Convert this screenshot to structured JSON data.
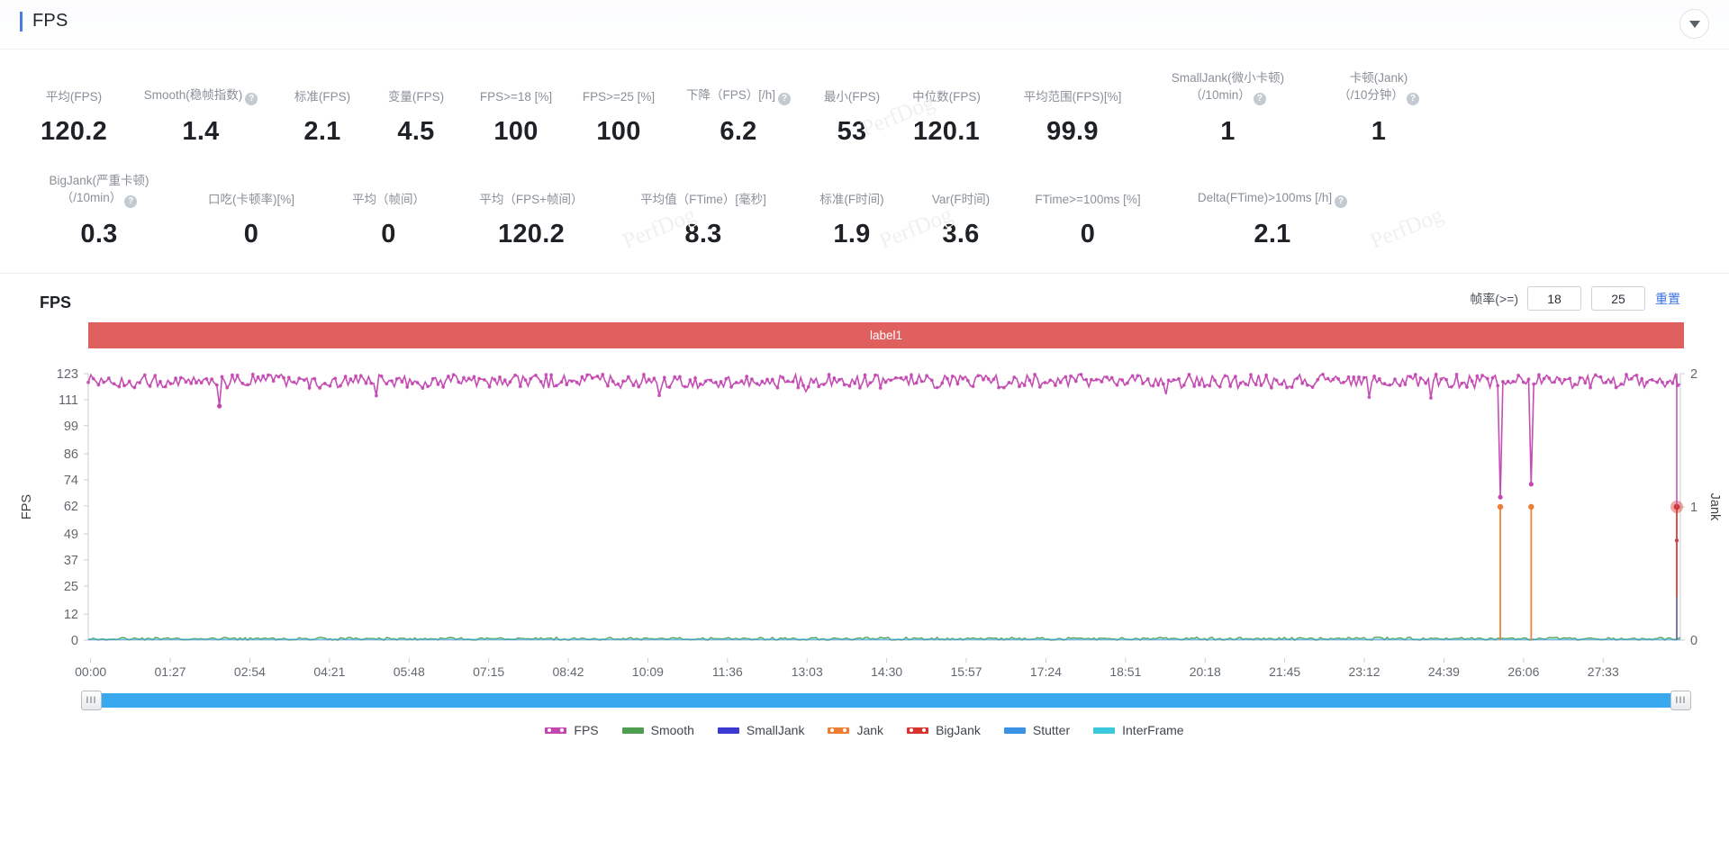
{
  "header": {
    "title": "FPS",
    "collapse_icon": "chevron-down-icon"
  },
  "stats": {
    "row1": [
      {
        "label": "平均(FPS)",
        "label2": "",
        "help": false,
        "value": "120.2"
      },
      {
        "label": "Smooth(稳帧指数)",
        "label2": "",
        "help": true,
        "value": "1.4"
      },
      {
        "label": "标准(FPS)",
        "label2": "",
        "help": false,
        "value": "2.1"
      },
      {
        "label": "变量(FPS)",
        "label2": "",
        "help": false,
        "value": "4.5"
      },
      {
        "label": "FPS>=18 [%]",
        "label2": "",
        "help": false,
        "value": "100"
      },
      {
        "label": "FPS>=25 [%]",
        "label2": "",
        "help": false,
        "value": "100"
      },
      {
        "label": "下降（FPS）[/h]",
        "label2": "",
        "help": true,
        "value": "6.2"
      },
      {
        "label": "最小(FPS)",
        "label2": "",
        "help": false,
        "value": "53"
      },
      {
        "label": "中位数(FPS)",
        "label2": "",
        "help": false,
        "value": "120.1"
      },
      {
        "label": "平均范围(FPS)[%]",
        "label2": "",
        "help": false,
        "value": "99.9"
      },
      {
        "label": "SmallJank(微小卡顿)",
        "label2": "（/10min）",
        "help": true,
        "value": "1"
      },
      {
        "label": "卡顿(Jank)",
        "label2": "（/10分钟）",
        "help": true,
        "value": "1"
      }
    ],
    "row2": [
      {
        "label": "BigJank(严重卡顿)",
        "label2": "（/10min）",
        "help": true,
        "value": "0.3"
      },
      {
        "label": "口吃(卡顿率)[%]",
        "label2": "",
        "help": false,
        "value": "0"
      },
      {
        "label": "平均（帧间）",
        "label2": "",
        "help": false,
        "value": "0"
      },
      {
        "label": "平均（FPS+帧间）",
        "label2": "",
        "help": false,
        "value": "120.2"
      },
      {
        "label": "平均值（FTime）[毫秒]",
        "label2": "",
        "help": false,
        "value": "8.3"
      },
      {
        "label": "标准(F时间)",
        "label2": "",
        "help": false,
        "value": "1.9"
      },
      {
        "label": "Var(F时间)",
        "label2": "",
        "help": false,
        "value": "3.6"
      },
      {
        "label": "FTime>=100ms [%]",
        "label2": "",
        "help": false,
        "value": "0"
      },
      {
        "label": "Delta(FTime)>100ms [/h]",
        "label2": "",
        "help": true,
        "value": "2.1"
      }
    ]
  },
  "watermarks": [
    "PerfDog",
    "PerfDog",
    "PerfDog",
    "PerfDog",
    "PerfDog",
    "PerfDog"
  ],
  "chart_panel": {
    "title": "FPS",
    "frame_rate_label": "帧率(>=)",
    "threshold_low": "18",
    "threshold_high": "25",
    "reset_label": "重置",
    "label_bar_text": "label1",
    "label_bar_color": "#e06060"
  },
  "scrollbar": {
    "left_handle": "III",
    "right_handle": "III",
    "track_color": "#38a9ef"
  },
  "chart_data": {
    "type": "line",
    "title": "FPS",
    "xlabel": "",
    "ylabel": "FPS",
    "y2label": "Jank",
    "ylim": [
      0,
      123
    ],
    "y2lim": [
      0,
      2
    ],
    "grid": false,
    "legend_position": "bottom",
    "yticks": [
      0,
      12,
      25,
      37,
      49,
      62,
      74,
      86,
      99,
      111,
      123
    ],
    "y2ticks": [
      0,
      1,
      2
    ],
    "xticks": [
      "00:00",
      "01:27",
      "02:54",
      "04:21",
      "05:48",
      "07:15",
      "08:42",
      "10:09",
      "11:36",
      "13:03",
      "14:30",
      "15:57",
      "17:24",
      "18:51",
      "20:18",
      "21:45",
      "23:12",
      "24:39",
      "26:06",
      "27:33"
    ],
    "series": [
      {
        "name": "FPS",
        "color": "#c245b0",
        "axis": "left",
        "mean": 119.5,
        "min": 53,
        "max": 123,
        "noise": 3.2
      },
      {
        "name": "Smooth",
        "color": "#4f9e50",
        "axis": "left",
        "mean": 1.4,
        "min": 0,
        "max": 4,
        "noise": 1.2
      },
      {
        "name": "SmallJank",
        "color": "#3b3bd4",
        "axis": "right",
        "mean": 0,
        "min": 0,
        "max": 1,
        "noise": 0
      },
      {
        "name": "Jank",
        "color": "#ef7d32",
        "axis": "right",
        "mean": 0,
        "min": 0,
        "max": 1,
        "noise": 0
      },
      {
        "name": "BigJank",
        "color": "#d6342c",
        "axis": "right",
        "mean": 0,
        "min": 0,
        "max": 1,
        "noise": 0
      },
      {
        "name": "Stutter",
        "color": "#3a92e5",
        "axis": "left",
        "mean": 0,
        "min": 0,
        "max": 1,
        "noise": 0
      },
      {
        "name": "InterFrame",
        "color": "#3cc8dc",
        "axis": "left",
        "mean": 0,
        "min": 0,
        "max": 1,
        "noise": 0
      }
    ],
    "jank_spikes": [
      {
        "x_label": "26:06",
        "value": 1,
        "color": "#ef7d32"
      },
      {
        "x_label": "26:30",
        "value": 1,
        "color": "#ef7d32"
      },
      {
        "x_label": "28:40",
        "value": 1,
        "color": "#d6342c"
      }
    ],
    "fps_dips": [
      {
        "x_label": "26:06",
        "value": 66
      },
      {
        "x_label": "26:30",
        "value": 72
      },
      {
        "x_label": "02:20",
        "value": 108
      }
    ],
    "annotations": [
      "label1"
    ]
  },
  "legend": [
    {
      "name": "FPS",
      "color": "#c245b0",
      "dotted": true
    },
    {
      "name": "Smooth",
      "color": "#4f9e50",
      "dotted": false
    },
    {
      "name": "SmallJank",
      "color": "#3b3bd4",
      "dotted": false
    },
    {
      "name": "Jank",
      "color": "#ef7d32",
      "dotted": true
    },
    {
      "name": "BigJank",
      "color": "#d6342c",
      "dotted": true
    },
    {
      "name": "Stutter",
      "color": "#3a92e5",
      "dotted": false
    },
    {
      "name": "InterFrame",
      "color": "#3cc8dc",
      "dotted": false
    }
  ]
}
